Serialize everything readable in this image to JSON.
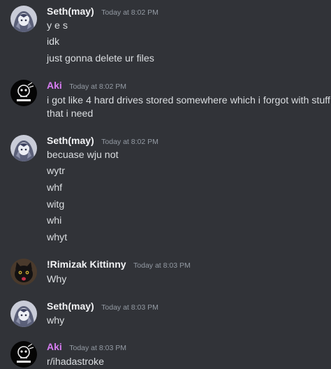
{
  "colors": {
    "background": "#313338",
    "text": "#dbdee1",
    "timestamp": "#949ba4",
    "seth_name": "#f2f3f5",
    "aki_name": "#d77df2",
    "rimizak_name": "#f2f3f5"
  },
  "messages": [
    {
      "author": "Seth(may)",
      "timestamp": "Today at 8:02 PM",
      "avatar_icon": "anime-girl-avatar-icon",
      "lines": [
        "y e s",
        "idk",
        "just gonna delete ur files"
      ]
    },
    {
      "author": "Aki",
      "timestamp": "Today at 8:02 PM",
      "avatar_icon": "skull-logo-avatar-icon",
      "lines": [
        "i got like 4 hard drives stored somewhere which i forgot with stuff",
        "that i need"
      ]
    },
    {
      "author": "Seth(may)",
      "timestamp": "Today at 8:02 PM",
      "avatar_icon": "anime-girl-avatar-icon",
      "lines": [
        "becuase wju not",
        "wytr",
        "whf",
        "witg",
        "whi",
        "whyt"
      ]
    },
    {
      "author": "!Rimizak Kittinny",
      "timestamp": "Today at 8:03 PM",
      "avatar_icon": "black-cat-avatar-icon",
      "lines": [
        "Why"
      ]
    },
    {
      "author": "Seth(may)",
      "timestamp": "Today at 8:03 PM",
      "avatar_icon": "anime-girl-avatar-icon",
      "lines": [
        "why"
      ]
    },
    {
      "author": "Aki",
      "timestamp": "Today at 8:03 PM",
      "avatar_icon": "skull-logo-avatar-icon",
      "lines": [
        "r/ihadastroke"
      ]
    }
  ]
}
